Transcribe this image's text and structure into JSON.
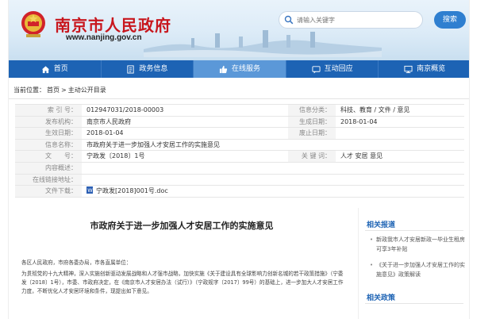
{
  "header": {
    "site_title": "南京市人民政府",
    "site_url": "www.nanjing.gov.cn",
    "search_placeholder": "请输入关键字",
    "search_button": "搜索",
    "colors": {
      "brand_red": "#c8161d",
      "nav_blue": "#1d63b4",
      "nav_active": "#5b98d8"
    }
  },
  "nav": {
    "items": [
      {
        "label": "首页",
        "icon": "home-icon"
      },
      {
        "label": "政务信息",
        "icon": "document-icon"
      },
      {
        "label": "在线服务",
        "icon": "thumbs-up-icon",
        "active": true
      },
      {
        "label": "互动回应",
        "icon": "chat-icon"
      },
      {
        "label": "南京概览",
        "icon": "monitor-icon"
      }
    ]
  },
  "breadcrumb": {
    "prefix": "当前位置：",
    "home": "首页",
    "sep": ">",
    "current": "主动公开目录"
  },
  "info": {
    "index_label": "索 引 号：",
    "index_value": "012947031/2018-00003",
    "category_label": "信息分类：",
    "category_value": "科技、教育 / 文件 / 意见",
    "publisher_label": "发布机构：",
    "publisher_value": "南京市人民政府",
    "gen_date_label": "生成日期：",
    "gen_date_value": "2018-01-04",
    "effective_label": "生效日期：",
    "effective_value": "2018-01-04",
    "repeal_label": "废止日期：",
    "repeal_value": "",
    "name_label": "信息名称：",
    "name_value": "市政府关于进一步加强人才安居工作的实施意见",
    "docno_label": "文　　号：",
    "docno_value": "宁政发〔2018〕1号",
    "keywords_label": "关 键 词：",
    "keywords_value": "人才 安居 意见",
    "summary_label": "内容概述：",
    "summary_value": "",
    "link_label": "在线链接地址：",
    "link_value": "",
    "download_label": "文件下载：",
    "download_value": "宁政发[2018]001号.doc"
  },
  "article": {
    "title": "市政府关于进一步加强人才安居工作的实施意见",
    "greeting": "各区人民政府，市府各委办局，市各直属单位：",
    "body": "为贯彻党的十九大精神，深入实施创新驱动发展战略和人才强市战略，加快实施《关于建设具有全球影响力创新名城的若干政策措施》（宁委发〔2018〕1号），市委、市政府决定，在《南京市人才安居办法（试行）》（宁政规字〔2017〕99号）的基础上，进一步加大人才安居工作力度，不断优化人才安居环境和条件，现提出如下意见。"
  },
  "sidebar": {
    "related_reports": "相关报道",
    "reports": [
      "新政我市人才安居新政一毕业生租房可享3年补贴",
      "《关于进一步加强人才安居工作的实施意见》政策解读"
    ],
    "related_policies": "相关政策"
  }
}
